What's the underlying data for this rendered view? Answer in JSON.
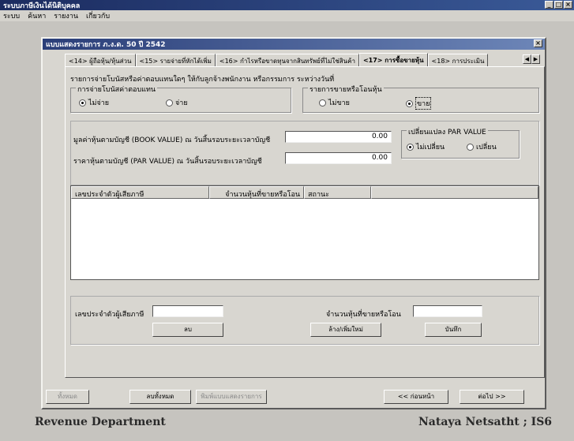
{
  "app": {
    "title": "ระบบภาษีเงินได้นิติบุคคล",
    "menu": [
      "ระบบ",
      "ค้นหา",
      "รายงาน",
      "เกี่ยวกับ"
    ]
  },
  "window": {
    "title": "แบบแสดงรายการ ภ.ง.ด. 50 ปี 2542"
  },
  "tabs": [
    {
      "label": "<14> ผู้ถือหุ้น/หุ้นส่วน"
    },
    {
      "label": "<15> รายจ่ายที่หักได้เพิ่ม"
    },
    {
      "label": "<16> กำไรหรือขาดทุนจากสินทรัพย์ที่ไม่ใช่สินค้า"
    },
    {
      "label": "<17> การซื้อขายหุ้น"
    },
    {
      "label": "<18> การประเมิน"
    }
  ],
  "section": {
    "heading": "รายการจ่ายโบนัสหรือค่าตอบแทนใดๆ ให้กับลูกจ้างพนักงาน หรือกรรมการ ระหว่างวันที่",
    "bonus_group": {
      "label": "การจ่ายโบนัสค่าตอบแทน",
      "options": [
        "ไม่จ่าย",
        "จ่าย"
      ],
      "selected": 0
    },
    "transfer_group": {
      "label": "รายการขายหรือโอนหุ้น",
      "options": [
        "ไม่ขาย",
        "ขาย"
      ],
      "selected": 1
    },
    "book_value_label": "มูลค่าหุ้นตามบัญชี (BOOK VALUE) ณ วันสิ้นรอบระยะเวลาบัญชี",
    "book_value": "0.00",
    "par_value_label": "ราคาหุ้นตามบัญชี (PAR VALUE) ณ วันสิ้นรอบระยะเวลาบัญชี",
    "par_value": "0.00",
    "par_change_group": {
      "label": "เปลี่ยนแปลง PAR VALUE",
      "options": [
        "ไม่เปลี่ยน",
        "เปลี่ยน"
      ],
      "selected": 0
    }
  },
  "table": {
    "columns": [
      "เลขประจำตัวผู้เสียภาษี",
      "จำนวนหุ้นที่ขายหรือโอน",
      "สถานะ"
    ]
  },
  "entry": {
    "tax_id_label": "เลขประจำตัวผู้เสียภาษี",
    "tax_id_value": "",
    "shares_label": "จำนวนหุ้นที่ขายหรือโอน",
    "shares_value": "",
    "delete_button": "ลบ",
    "add_button": "ล้าง/เพิ่มใหม่",
    "save_button": "บันทึก"
  },
  "bottom_buttons": {
    "all": "ทั้งหมด",
    "clear_all": "ลบทั้งหมด",
    "print": "พิมพ์แบบแสดงรายการ",
    "prev": "<< ก่อนหน้า",
    "next": "ต่อไป >>"
  },
  "footer": {
    "left": "Revenue Department",
    "right": "Nataya Netsatht ; IS6"
  }
}
